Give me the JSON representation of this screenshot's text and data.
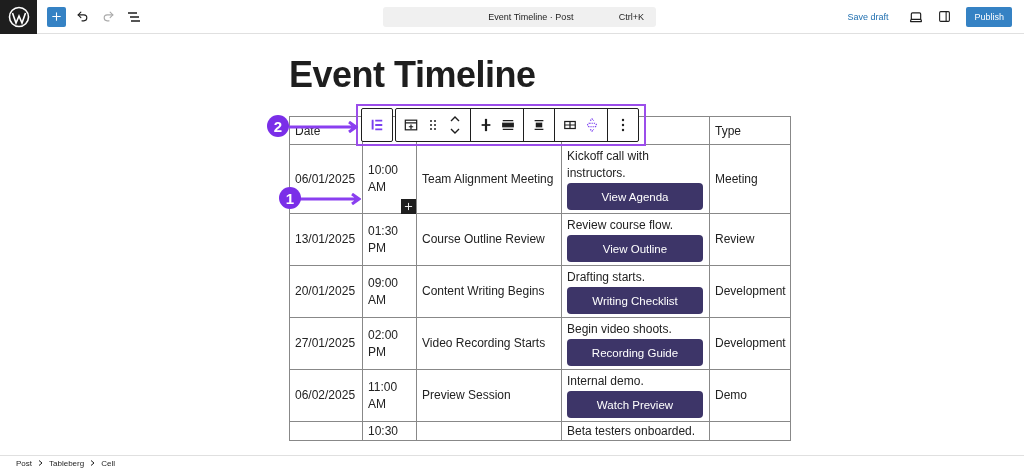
{
  "topbar": {
    "command_title": "Event Timeline · Post",
    "command_shortcut": "Ctrl+K",
    "save_draft": "Save draft",
    "publish": "Publish"
  },
  "post_title": "Event Timeline",
  "toolbar": [
    [
      {
        "kind": "parent",
        "selected": true
      }
    ],
    [
      {
        "kind": "insert",
        "selected": false
      },
      {
        "kind": "drag",
        "selected": false
      },
      {
        "kind": "move",
        "selected": false
      }
    ],
    [
      {
        "kind": "middle",
        "selected": false
      },
      {
        "kind": "stretch",
        "selected": false
      }
    ],
    [
      {
        "kind": "box",
        "selected": false
      }
    ],
    [
      {
        "kind": "grid",
        "selected": false
      },
      {
        "kind": "span",
        "selected": true
      }
    ],
    [
      {
        "kind": "more",
        "selected": false
      }
    ]
  ],
  "table": {
    "header": {
      "column_1": "Date",
      "column_5": "Type"
    },
    "rows": [
      {
        "date": "06/01/2025",
        "time": "10:00 AM",
        "event": "Team Alignment Meeting",
        "note": "Kickoff call with instructors.",
        "button": "View Agenda",
        "type": "Meeting"
      },
      {
        "date": "13/01/2025",
        "time": "01:30 PM",
        "event": "Course Outline Review",
        "note": "Review course flow.",
        "button": "View Outline",
        "type": "Review"
      },
      {
        "date": "20/01/2025",
        "time": "09:00 AM",
        "event": "Content Writing Begins",
        "note": "Drafting starts.",
        "button": "Writing Checklist",
        "type": "Development"
      },
      {
        "date": "27/01/2025",
        "time": "02:00 PM",
        "event": "Video Recording Starts",
        "note": "Begin video shoots.",
        "button": "Recording Guide",
        "type": "Development"
      },
      {
        "date": "06/02/2025",
        "time": "11:00 AM",
        "event": "Preview Session",
        "note": "Internal demo.",
        "button": "Watch Preview",
        "type": "Demo"
      },
      {
        "time": "10:30",
        "note": "Beta testers onboarded."
      }
    ]
  },
  "annotations": [
    {
      "number": "2"
    },
    {
      "number": "1"
    }
  ],
  "breadcrumb": [
    "Post",
    "Tableberg",
    "Cell"
  ]
}
